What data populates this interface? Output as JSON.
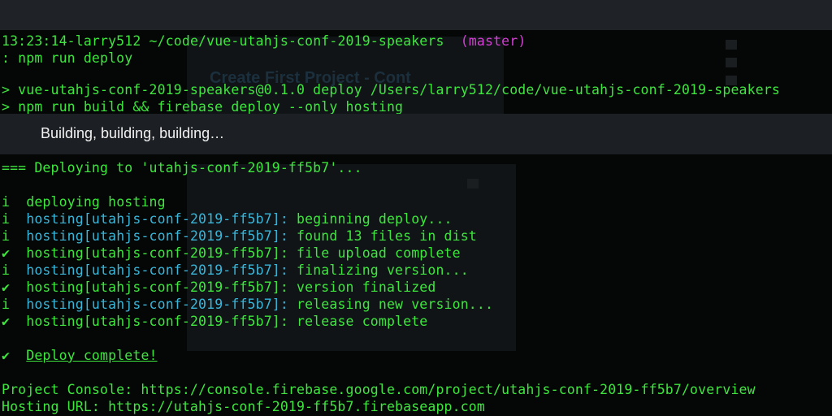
{
  "prompt": {
    "time": "13:23:14",
    "user": "larry512",
    "path": "~/code/vue-utahjs-conf-2019-speakers",
    "branch": "(master)"
  },
  "command": ": npm run deploy",
  "npm_lines": [
    "> vue-utahjs-conf-2019-speakers@0.1.0 deploy /Users/larry512/code/vue-utahjs-conf-2019-speakers",
    "> npm run build && firebase deploy --only hosting"
  ],
  "caption": "Building, building, building…",
  "background_text": "Create First Project - Cont",
  "deploy_header": "=== Deploying to 'utahjs-conf-2019-ff5b7'...",
  "deploying_line": {
    "mark": "i",
    "text": "deploying hosting"
  },
  "hosting_lines": [
    {
      "mark": "i",
      "target": "hosting[utahjs-conf-2019-ff5b7]:",
      "message": "beginning deploy..."
    },
    {
      "mark": "i",
      "target": "hosting[utahjs-conf-2019-ff5b7]:",
      "message": "found 13 files in dist"
    },
    {
      "mark": "✔",
      "target": "hosting[utahjs-conf-2019-ff5b7]:",
      "message": "file upload complete"
    },
    {
      "mark": "i",
      "target": "hosting[utahjs-conf-2019-ff5b7]:",
      "message": "finalizing version..."
    },
    {
      "mark": "✔",
      "target": "hosting[utahjs-conf-2019-ff5b7]:",
      "message": "version finalized"
    },
    {
      "mark": "i",
      "target": "hosting[utahjs-conf-2019-ff5b7]:",
      "message": "releasing new version..."
    },
    {
      "mark": "✔",
      "target": "hosting[utahjs-conf-2019-ff5b7]:",
      "message": "release complete"
    }
  ],
  "complete": {
    "mark": "✔",
    "text": "Deploy complete!"
  },
  "console_line": "Project Console: https://console.firebase.google.com/project/utahjs-conf-2019-ff5b7/overview",
  "hosting_url_line": "Hosting URL: https://utahjs-conf-2019-ff5b7.firebaseapp.com",
  "colors": {
    "green": "#3ee63e",
    "cyan": "#39b6d9",
    "magenta": "#d23fd2",
    "terminal_bg": "#050606",
    "caption_bg": "#1c2024"
  }
}
